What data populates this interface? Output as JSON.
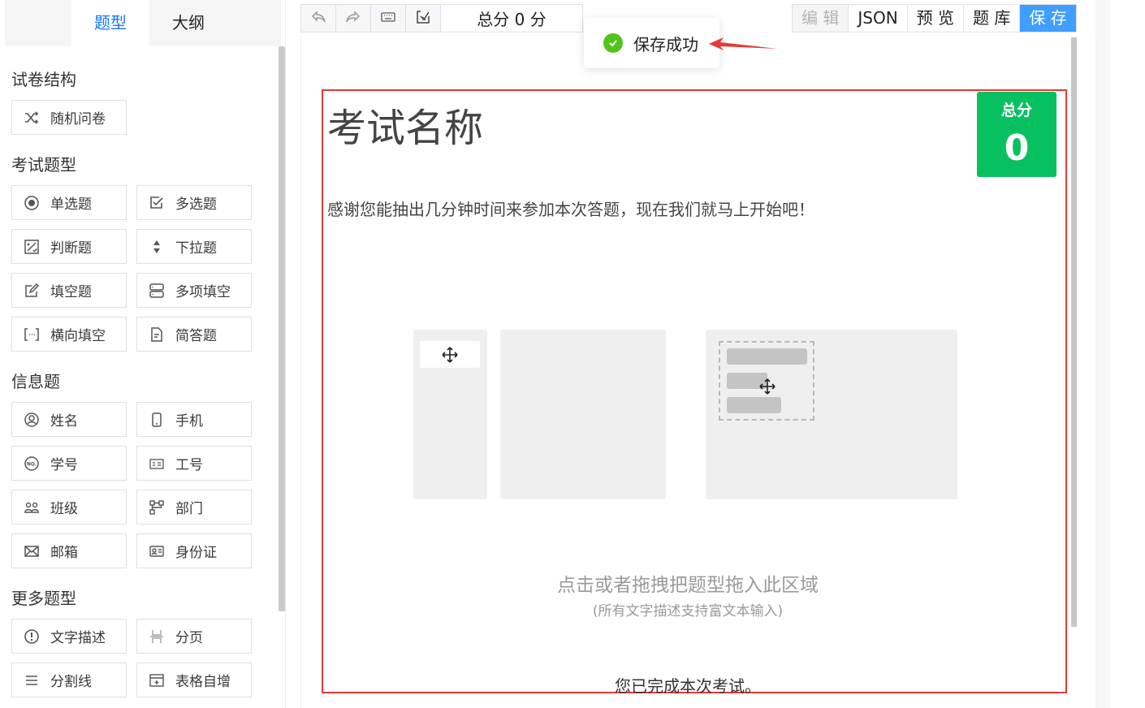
{
  "sidebar": {
    "tabs": [
      "题型",
      "大纲"
    ],
    "sections": {
      "structure": "试卷结构",
      "exam_types": "考试题型",
      "info": "信息题",
      "more": "更多题型"
    },
    "buttons": {
      "random": "随机问卷",
      "single": "单选题",
      "multi": "多选题",
      "judge": "判断题",
      "dropdown": "下拉题",
      "fill": "填空题",
      "multifill": "多项填空",
      "hfill": "横向填空",
      "essay": "简答题",
      "name": "姓名",
      "phone": "手机",
      "student_id": "学号",
      "employee_id": "工号",
      "class": "班级",
      "department": "部门",
      "email": "邮箱",
      "id_card": "身份证",
      "text_desc": "文字描述",
      "page": "分页",
      "divider": "分割线",
      "table": "表格自增"
    }
  },
  "toolbar": {
    "score": "总分 0 分",
    "edit": "编 辑",
    "json": "JSON",
    "preview": "预 览",
    "bank": "题 库",
    "save": "保 存"
  },
  "toast": {
    "message": "保存成功"
  },
  "exam": {
    "title": "考试名称",
    "score_label": "总分",
    "score_value": "0",
    "description": "感谢您能抽出几分钟时间来参加本次答题，现在我们就马上开始吧！",
    "drop_hint": "点击或者拖拽把题型拖入此区域",
    "drop_sub": "(所有文字描述支持富文本输入)",
    "finish": "您已完成本次考试。"
  },
  "colors": {
    "primary": "#409eff",
    "active_tab": "#1677ff",
    "score_green": "#07c160",
    "success": "#52c41a",
    "highlight_red": "#e53935"
  }
}
